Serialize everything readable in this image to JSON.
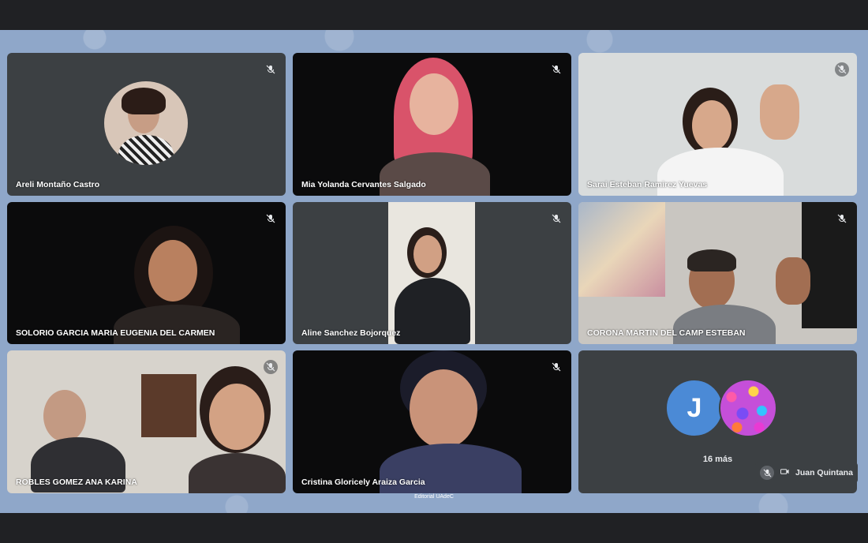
{
  "participants": [
    {
      "name": "Areli Montaño Castro"
    },
    {
      "name": "Mia Yolanda Cervantes Salgado"
    },
    {
      "name": "Sarai Esteban Ramirez Yuevas"
    },
    {
      "name": "SOLORIO GARCIA MARIA EUGENIA DEL CARMEN"
    },
    {
      "name": "Aline Sanchez Bojorquez"
    },
    {
      "name": "CORONA MARTIN DEL CAMP ESTEBAN"
    },
    {
      "name": "ROBLES GOMEZ ANA KARINA"
    },
    {
      "name": "Cristina Gloricely Araiza Garcia"
    }
  ],
  "more": {
    "initial": "J",
    "count_label": "16 más"
  },
  "presenter": {
    "name": "Juan Quintana"
  },
  "footer": {
    "text": "Editorial UAdeC"
  },
  "colors": {
    "tile_bg": "#3c4043",
    "stage_bg": "#8fa7c9",
    "avatar_j": "#4b8ad6"
  },
  "icons": {
    "mic": "mic-off-icon",
    "camera": "camera-icon"
  }
}
